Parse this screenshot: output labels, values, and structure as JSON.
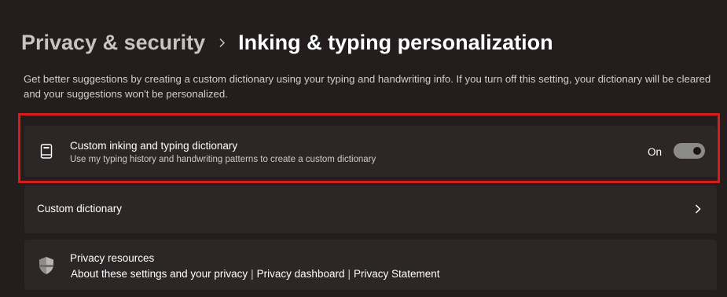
{
  "breadcrumb": {
    "parent": "Privacy & security",
    "current": "Inking & typing personalization"
  },
  "description": "Get better suggestions by creating a custom dictionary using your typing and handwriting info. If you turn off this setting, your dictionary will be cleared and your suggestions won't be personalized.",
  "dictionary_setting": {
    "icon": "book-icon",
    "title": "Custom inking and typing dictionary",
    "subtitle": "Use my typing history and handwriting patterns to create a custom dictionary",
    "toggle_state": "On",
    "toggle_on": true
  },
  "custom_dictionary": {
    "label": "Custom dictionary",
    "icon": "chevron-right-icon"
  },
  "privacy_resources": {
    "icon": "shield-icon",
    "title": "Privacy resources",
    "links": [
      "About these settings and your privacy",
      "Privacy dashboard",
      "Privacy Statement"
    ],
    "separator": "|"
  },
  "colors": {
    "background": "#231d1d",
    "card": "#2c2626",
    "highlight": "#d81c1c",
    "toggle_track": "#8d8a8a"
  }
}
